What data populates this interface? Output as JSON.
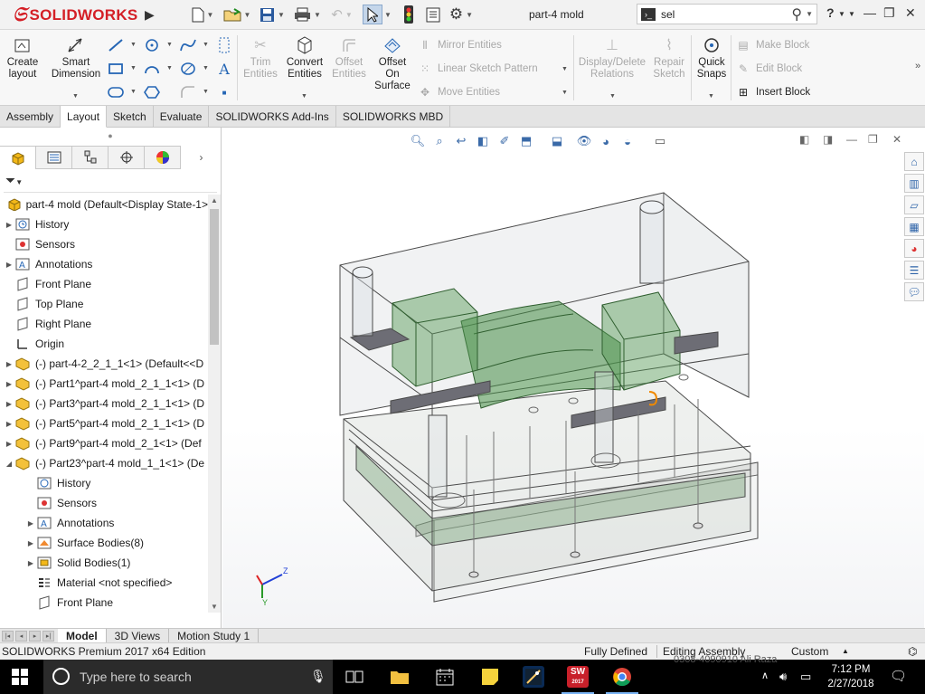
{
  "app": {
    "brand": "SOLIDWORKS",
    "document_title": "part-4 mold",
    "search_value": "sel"
  },
  "ribbon": {
    "create_layout": "Create\nlayout",
    "smart_dimension": "Smart\nDimension",
    "trim_entities": "Trim\nEntities",
    "convert_entities": "Convert\nEntities",
    "offset_entities": "Offset\nEntities",
    "offset_on_surface": "Offset\nOn\nSurface",
    "mirror_entities": "Mirror Entities",
    "linear_sketch_pattern": "Linear Sketch Pattern",
    "move_entities": "Move Entities",
    "display_delete_relations": "Display/Delete\nRelations",
    "repair_sketch": "Repair\nSketch",
    "quick_snaps": "Quick\nSnaps",
    "make_block": "Make Block",
    "edit_block": "Edit Block",
    "insert_block": "Insert Block"
  },
  "tabs": [
    "Assembly",
    "Layout",
    "Sketch",
    "Evaluate",
    "SOLIDWORKS Add-Ins",
    "SOLIDWORKS MBD"
  ],
  "active_tab": "Layout",
  "tree": {
    "root": "part-4 mold  (Default<Display State-1>",
    "items": [
      {
        "label": "History"
      },
      {
        "label": "Sensors"
      },
      {
        "label": "Annotations"
      },
      {
        "label": "Front Plane"
      },
      {
        "label": "Top Plane"
      },
      {
        "label": "Right Plane"
      },
      {
        "label": "Origin"
      },
      {
        "label": "(-) part-4-2_2_1_1<1> (Default<<D"
      },
      {
        "label": "(-) Part1^part-4 mold_2_1_1<1> (D"
      },
      {
        "label": "(-) Part3^part-4 mold_2_1_1<1> (D"
      },
      {
        "label": "(-) Part5^part-4 mold_2_1_1<1> (D"
      },
      {
        "label": "(-) Part9^part-4 mold_2_1<1> (Def"
      },
      {
        "label": "(-) Part23^part-4 mold_1_1<1> (De"
      },
      {
        "label": "History"
      },
      {
        "label": "Sensors"
      },
      {
        "label": "Annotations"
      },
      {
        "label": "Surface Bodies(8)"
      },
      {
        "label": "Solid Bodies(1)"
      },
      {
        "label": "Material <not specified>"
      },
      {
        "label": "Front Plane"
      }
    ]
  },
  "model_tabs": [
    "Model",
    "3D Views",
    "Motion Study 1"
  ],
  "status": {
    "edition": "SOLIDWORKS Premium 2017 x64 Edition",
    "defined": "Fully Defined",
    "editing": "Editing Assembly",
    "units": "Custom"
  },
  "taskbar": {
    "search_placeholder": "Type here to search",
    "time": "7:12 PM",
    "date": "2/27/2018",
    "sw_badge": "2017",
    "ghost_text": "0308-4090910  Ali Raza"
  },
  "colors": {
    "brand_red": "#d41f26",
    "mold_green": "#3f7a3f",
    "taskbar": "#000000"
  }
}
